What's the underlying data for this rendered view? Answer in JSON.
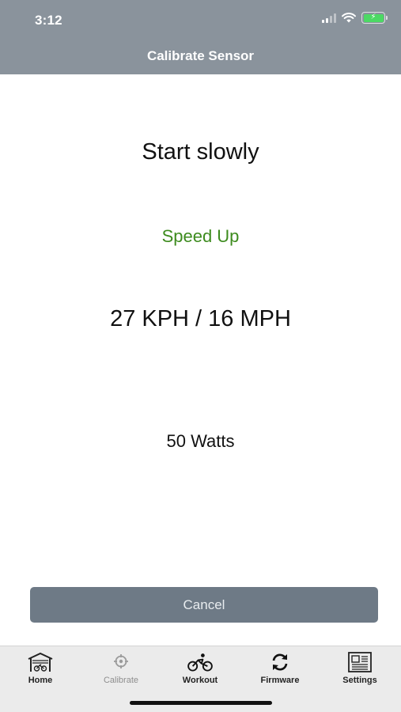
{
  "status_bar": {
    "time": "3:12"
  },
  "header": {
    "title": "Calibrate Sensor"
  },
  "main": {
    "instruction": "Start slowly",
    "status_message": "Speed Up",
    "speed": "27 KPH / 16 MPH",
    "power": "50 Watts"
  },
  "actions": {
    "cancel_label": "Cancel"
  },
  "tabbar": {
    "tabs": [
      {
        "label": "Home",
        "icon": "garage-bike-icon",
        "enabled": true
      },
      {
        "label": "Calibrate",
        "icon": "crosshair-icon",
        "enabled": false
      },
      {
        "label": "Workout",
        "icon": "cyclist-icon",
        "enabled": true
      },
      {
        "label": "Firmware",
        "icon": "refresh-icon",
        "enabled": true
      },
      {
        "label": "Settings",
        "icon": "newspaper-icon",
        "enabled": true
      }
    ]
  },
  "colors": {
    "header_bg": "#8a939c",
    "status_green": "#3d8b1e",
    "button_bg": "#6e7a86",
    "tabbar_bg": "#ebebeb"
  }
}
